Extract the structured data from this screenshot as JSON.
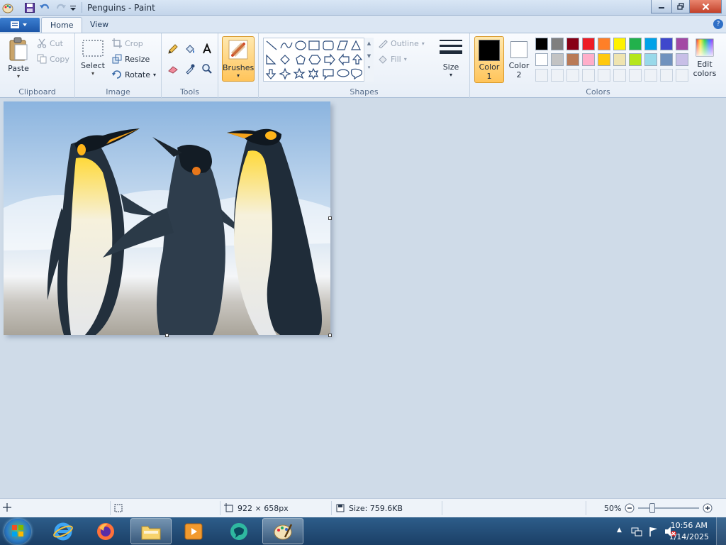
{
  "window": {
    "title": "Penguins - Paint"
  },
  "tabs": [
    {
      "label": "Home",
      "active": true
    },
    {
      "label": "View",
      "active": false
    }
  ],
  "ribbon": {
    "clipboard": {
      "label": "Clipboard",
      "paste": "Paste",
      "cut": "Cut",
      "copy": "Copy"
    },
    "image": {
      "label": "Image",
      "select": "Select",
      "crop": "Crop",
      "resize": "Resize",
      "rotate": "Rotate"
    },
    "tools": {
      "label": "Tools"
    },
    "brushes": {
      "label": "Brushes"
    },
    "shapes": {
      "label": "Shapes",
      "outline": "Outline",
      "fill": "Fill"
    },
    "size": {
      "label": "Size"
    },
    "colors": {
      "label": "Colors",
      "color1_line1": "Color",
      "color1_line2": "1",
      "color2_line1": "Color",
      "color2_line2": "2",
      "edit_line1": "Edit",
      "edit_line2": "colors",
      "color1_value": "#000000",
      "color2_value": "#ffffff",
      "palette_row1": [
        "#000000",
        "#7f7f7f",
        "#880015",
        "#ed1c24",
        "#ff7f27",
        "#fff200",
        "#22b14c",
        "#00a2e8",
        "#3f48cc",
        "#a349a4"
      ],
      "palette_row2": [
        "#ffffff",
        "#c3c3c3",
        "#b97a57",
        "#ffaec9",
        "#ffc90e",
        "#efe4b0",
        "#b5e61d",
        "#99d9ea",
        "#7092be",
        "#c8bfe7"
      ]
    }
  },
  "status": {
    "dimensions": "922 × 658px",
    "size": "Size: 759.6KB",
    "zoom": "50%"
  },
  "taskbar": {
    "time": "10:56 AM",
    "date": "1/14/2025"
  }
}
